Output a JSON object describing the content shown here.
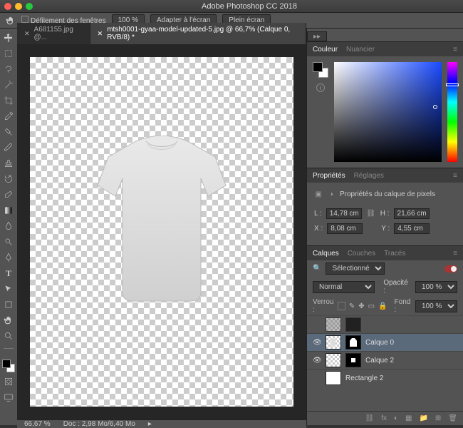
{
  "app_title": "Adobe Photoshop CC 2018",
  "options_bar": {
    "scroll_label": "Défilement des fenêtres",
    "zoom_100": "100 %",
    "fit_screen": "Adapter à l'écran",
    "full_screen": "Plein écran"
  },
  "tabs": [
    {
      "label": "A681155.jpg @...",
      "active": false
    },
    {
      "label": "mtsh0001-gyaa-model-updated-5.jpg @ 66,7% (Calque 0, RVB/8) *",
      "active": true
    }
  ],
  "status": {
    "zoom": "66,67 %",
    "doc": "Doc : 2,98 Mo/6,40 Mo"
  },
  "panels": {
    "color": {
      "tab1": "Couleur",
      "tab2": "Nuancier"
    },
    "props": {
      "tab1": "Propriétés",
      "tab2": "Réglages",
      "title": "Propriétés du calque de pixels",
      "L_label": "L :",
      "L": "14,78 cm",
      "H_label": "H :",
      "H": "21,66 cm",
      "X_label": "X :",
      "X": "8,08 cm",
      "Y_label": "Y :",
      "Y": "4,55 cm",
      "link_icon": "⛓"
    },
    "layers": {
      "tab1": "Calques",
      "tab2": "Couches",
      "tab3": "Tracés",
      "filter_label": "Sélectionné",
      "filter_icon": "🔍",
      "blend": "Normal",
      "opacity_label": "Opacité :",
      "opacity": "100 %",
      "lock_label": "Verrou :",
      "fill_label": "Fond :",
      "fill": "100 %",
      "items": [
        {
          "name": "Calque 0",
          "eye": "👁",
          "active": true,
          "has_mask": true
        },
        {
          "name": "Calque 2",
          "eye": "👁",
          "active": false,
          "has_mask": true
        },
        {
          "name": "Rectangle 2",
          "eye": "",
          "active": false,
          "has_mask": false
        }
      ]
    }
  },
  "tools_list": [
    "move",
    "marquee",
    "lasso",
    "wand",
    "crop",
    "eyedrop",
    "heal",
    "brush",
    "stamp",
    "history",
    "eraser",
    "gradient",
    "blur",
    "dodge",
    "pen",
    "type",
    "path",
    "shape",
    "hand",
    "zoom"
  ],
  "layer_foot_icons": [
    "⛓",
    "fx",
    "◐",
    "▦",
    "📁",
    "⊞",
    "🗑"
  ]
}
